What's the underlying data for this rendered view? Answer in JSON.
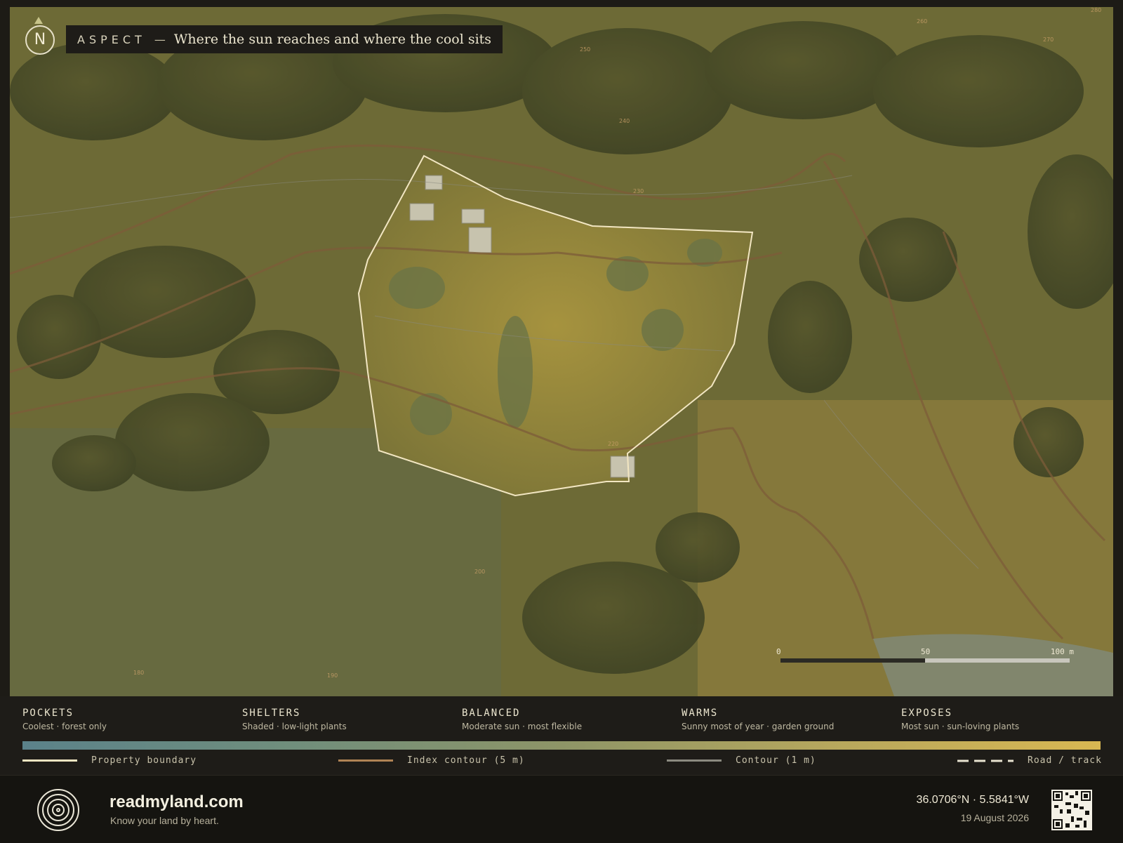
{
  "map": {
    "north_label": "N",
    "title_keyword": "ASPECT",
    "title_separator": "—",
    "title_subtitle": "Where the sun reaches and where the cool sits",
    "contour_numbers": [
      "250",
      "240",
      "230",
      "260",
      "270",
      "280",
      "200",
      "190",
      "180",
      "220"
    ],
    "scale": {
      "labels": [
        "0",
        "50",
        "100 m"
      ]
    }
  },
  "legend": {
    "categories": [
      {
        "name": "POCKETS",
        "desc": "Coolest · forest only"
      },
      {
        "name": "SHELTERS",
        "desc": "Shaded · low-light plants"
      },
      {
        "name": "BALANCED",
        "desc": "Moderate sun · most flexible"
      },
      {
        "name": "WARMS",
        "desc": "Sunny most of year · garden ground"
      },
      {
        "name": "EXPOSES",
        "desc": "Most sun · sun-loving plants"
      }
    ],
    "gradient_colors": [
      "#5b828a",
      "#708e7c",
      "#8e9567",
      "#b6a75d",
      "#d8b752"
    ],
    "keys": [
      {
        "label": "Property boundary",
        "color": "#f2e6c2"
      },
      {
        "label": "Index contour (5 m)",
        "color": "#b08455"
      },
      {
        "label": "Contour (1 m)",
        "color": "#8b8a80"
      },
      {
        "label": "Road / track",
        "color": "#e8e3d0"
      }
    ]
  },
  "footer": {
    "brand": "readmyland.com",
    "tagline": "Know your land by heart.",
    "coordinates": "36.0706°N · 5.5841°W",
    "date": "19 August 2026"
  }
}
